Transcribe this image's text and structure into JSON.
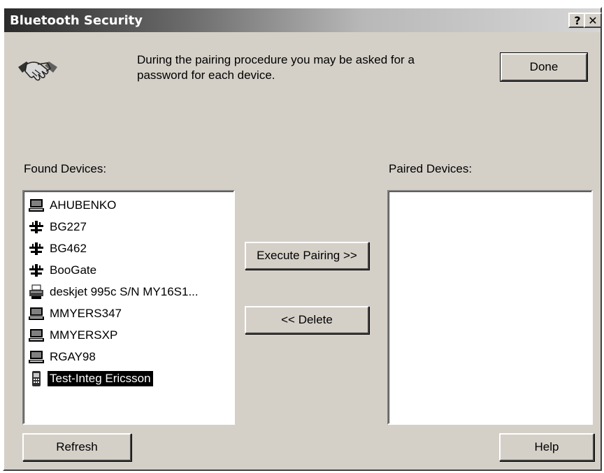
{
  "window": {
    "title": "Bluetooth Security",
    "help_btn": "?",
    "close_btn": "✕"
  },
  "header": {
    "line1": "During the pairing procedure you may be asked for a",
    "line2": "password for each device."
  },
  "buttons": {
    "done": "Done",
    "execute_pairing": "Execute Pairing >>",
    "delete": "<< Delete",
    "refresh": "Refresh",
    "help": "Help"
  },
  "found_devices": {
    "label": "Found Devices:",
    "items": [
      {
        "name": "AHUBENKO",
        "icon": "computer-icon"
      },
      {
        "name": "BG227",
        "icon": "network-device-icon"
      },
      {
        "name": "BG462",
        "icon": "network-device-icon"
      },
      {
        "name": "BooGate",
        "icon": "network-device-icon"
      },
      {
        "name": "deskjet 995c S/N MY16S1...",
        "icon": "printer-icon"
      },
      {
        "name": "MMYERS347",
        "icon": "computer-icon"
      },
      {
        "name": "MMYERSXP",
        "icon": "computer-icon"
      },
      {
        "name": "RGAY98",
        "icon": "computer-icon"
      },
      {
        "name": "Test-Integ Ericsson",
        "icon": "phone-icon",
        "selected": true
      }
    ]
  },
  "paired_devices": {
    "label": "Paired Devices:",
    "items": []
  }
}
